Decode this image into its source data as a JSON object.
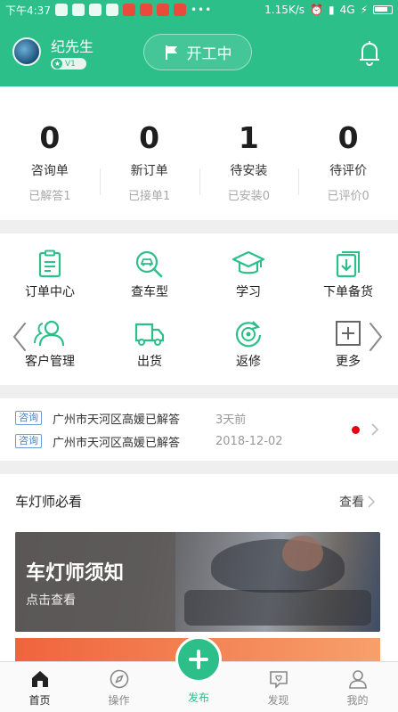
{
  "status_bar": {
    "time": "下午4:37",
    "network_speed": "1.15K/s",
    "signal": "4G",
    "more": "•••"
  },
  "header": {
    "username": "纪先生",
    "level": "V1",
    "work_status_button": "开工中"
  },
  "stats": [
    {
      "count": "0",
      "label": "咨询单",
      "sub": "已解答1"
    },
    {
      "count": "0",
      "label": "新订单",
      "sub": "已接单1"
    },
    {
      "count": "1",
      "label": "待安装",
      "sub": "已安装0"
    },
    {
      "count": "0",
      "label": "待评价",
      "sub": "已评价0"
    }
  ],
  "menu": [
    {
      "label": "订单中心",
      "icon": "clipboard-icon"
    },
    {
      "label": "查车型",
      "icon": "car-search-icon"
    },
    {
      "label": "学习",
      "icon": "graduation-cap-icon"
    },
    {
      "label": "下单备货",
      "icon": "download-box-icon"
    },
    {
      "label": "客户管理",
      "icon": "customers-icon"
    },
    {
      "label": "出货",
      "icon": "truck-icon"
    },
    {
      "label": "返修",
      "icon": "repair-cycle-icon"
    },
    {
      "label": "更多",
      "icon": "plus-square-icon"
    }
  ],
  "notices": [
    {
      "tag": "咨询",
      "text": "广州市天河区高媛已解答",
      "time": "3天前"
    },
    {
      "tag": "咨询",
      "text": "广州市天河区高媛已解答",
      "time": "2018-12-02"
    }
  ],
  "section": {
    "title": "车灯师必看",
    "more": "查看",
    "banner_title": "车灯师须知",
    "banner_subtitle": "点击查看"
  },
  "tabbar": {
    "home": "首页",
    "operate": "操作",
    "publish": "发布",
    "discover": "发现",
    "mine": "我的"
  },
  "colors": {
    "brand_green": "#2cbf8a",
    "notice_red_dot": "#e60012"
  }
}
